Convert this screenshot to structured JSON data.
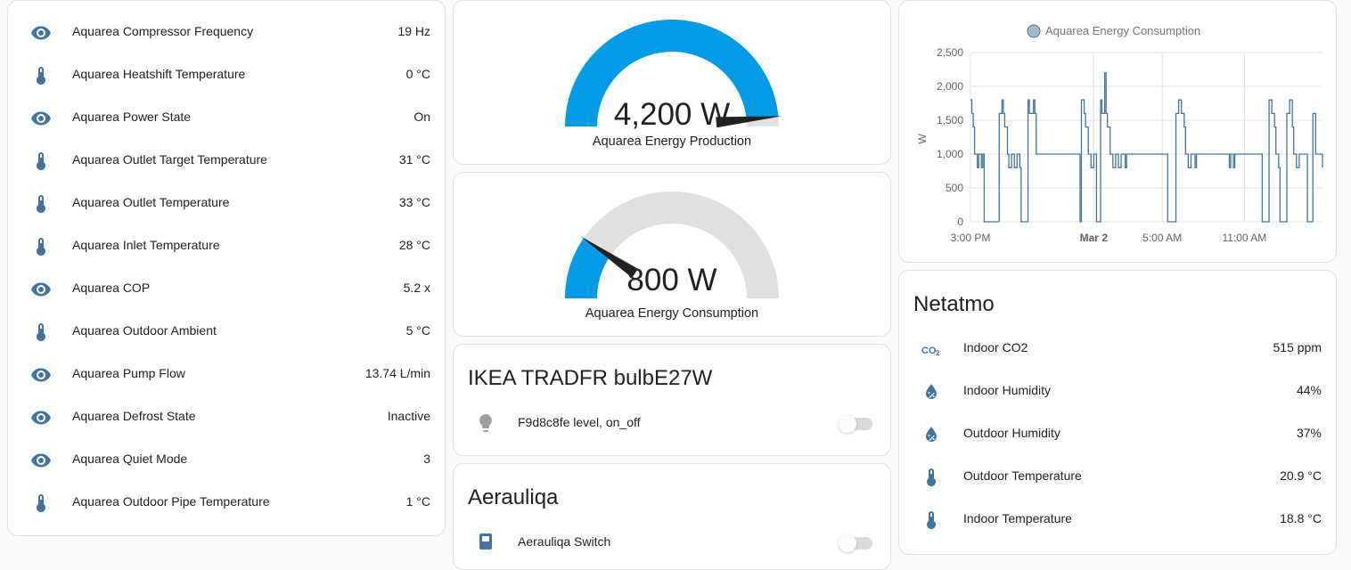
{
  "colors": {
    "icon": "#44739e",
    "gauge": "#039be5",
    "gauge_bg": "#e0e0e0",
    "line": "#44739e",
    "needle": "#212121"
  },
  "aquarea_card": {
    "rows": [
      {
        "icon": "eye-icon",
        "label": "Aquarea Compressor Frequency",
        "value": "19 Hz"
      },
      {
        "icon": "thermometer-icon",
        "label": "Aquarea Heatshift Temperature",
        "value": "0 °C"
      },
      {
        "icon": "eye-icon",
        "label": "Aquarea Power State",
        "value": "On"
      },
      {
        "icon": "thermometer-icon",
        "label": "Aquarea Outlet Target Temperature",
        "value": "31 °C"
      },
      {
        "icon": "thermometer-icon",
        "label": "Aquarea Outlet Temperature",
        "value": "33 °C"
      },
      {
        "icon": "thermometer-icon",
        "label": "Aquarea Inlet Temperature",
        "value": "28 °C"
      },
      {
        "icon": "eye-icon",
        "label": "Aquarea COP",
        "value": "5.2 x"
      },
      {
        "icon": "thermometer-icon",
        "label": "Aquarea Outdoor Ambient",
        "value": "5 °C"
      },
      {
        "icon": "eye-icon",
        "label": "Aquarea Pump Flow",
        "value": "13.74 L/min"
      },
      {
        "icon": "eye-icon",
        "label": "Aquarea Defrost State",
        "value": "Inactive"
      },
      {
        "icon": "eye-icon",
        "label": "Aquarea Quiet Mode",
        "value": "3"
      },
      {
        "icon": "thermometer-icon",
        "label": "Aquarea Outdoor Pipe Temperature",
        "value": "1 °C"
      }
    ]
  },
  "gauges": {
    "production": {
      "value_text": "4,200 W",
      "name": "Aquarea Energy Production",
      "fraction": 0.97
    },
    "consumption": {
      "value_text": "800 W",
      "name": "Aquarea Energy Consumption",
      "fraction": 0.19
    }
  },
  "ikea_card": {
    "title": "IKEA TRADFR bulbE27W",
    "entity": {
      "icon": "bulb-icon",
      "label": "F9d8c8fe level, on_off",
      "state": "off"
    }
  },
  "aerauliqa_card": {
    "title": "Aerauliqa",
    "entity": {
      "icon": "fan-switch-icon",
      "label": "Aerauliqa Switch",
      "state": "off"
    }
  },
  "netatmo_card": {
    "title": "Netatmo",
    "rows": [
      {
        "icon": "co2-icon",
        "label": "Indoor CO2",
        "value": "515 ppm"
      },
      {
        "icon": "humidity-icon",
        "label": "Indoor Humidity",
        "value": "44%"
      },
      {
        "icon": "humidity-icon",
        "label": "Outdoor Humidity",
        "value": "37%"
      },
      {
        "icon": "thermometer-icon",
        "label": "Outdoor Temperature",
        "value": "20.9 °C"
      },
      {
        "icon": "thermometer-icon",
        "label": "Indoor Temperature",
        "value": "18.8 °C"
      }
    ]
  },
  "chart_data": {
    "type": "line",
    "title": "",
    "legend": {
      "label": "Aquarea Energy Consumption",
      "placement": "top"
    },
    "ylabel": "W",
    "xlabel": "",
    "ylim": [
      0,
      2500
    ],
    "yticks": [
      "0",
      "500",
      "1,000",
      "1,500",
      "2,000",
      "2,500"
    ],
    "xticks": [
      "3:00 PM",
      "Mar 2",
      "5:00 AM",
      "11:00 AM"
    ],
    "x_hours": [
      0,
      9,
      14,
      20
    ],
    "x_range_hours": [
      0,
      25.7
    ],
    "grid": true,
    "series": [
      {
        "name": "Aquarea Energy Consumption",
        "points": [
          [
            0.0,
            1800
          ],
          [
            0.1,
            1600
          ],
          [
            0.2,
            1400
          ],
          [
            0.3,
            1000
          ],
          [
            0.5,
            800
          ],
          [
            0.6,
            1000
          ],
          [
            0.8,
            800
          ],
          [
            0.9,
            1000
          ],
          [
            1.0,
            0
          ],
          [
            1.2,
            0
          ],
          [
            1.4,
            0
          ],
          [
            2.0,
            0
          ],
          [
            2.1,
            1600
          ],
          [
            2.3,
            1800
          ],
          [
            2.4,
            1600
          ],
          [
            2.5,
            1400
          ],
          [
            2.7,
            1000
          ],
          [
            2.8,
            800
          ],
          [
            3.0,
            1000
          ],
          [
            3.2,
            800
          ],
          [
            3.4,
            1000
          ],
          [
            3.6,
            800
          ],
          [
            3.7,
            0
          ],
          [
            4.1,
            0
          ],
          [
            4.2,
            1800
          ],
          [
            4.3,
            1600
          ],
          [
            4.6,
            1800
          ],
          [
            4.7,
            1600
          ],
          [
            4.8,
            1000
          ],
          [
            7.9,
            1000
          ],
          [
            8.0,
            0
          ],
          [
            8.1,
            1800
          ],
          [
            8.3,
            1600
          ],
          [
            8.4,
            1400
          ],
          [
            8.6,
            1000
          ],
          [
            8.8,
            800
          ],
          [
            9.0,
            1000
          ],
          [
            9.2,
            0
          ],
          [
            9.5,
            1800
          ],
          [
            9.6,
            1600
          ],
          [
            9.8,
            2200
          ],
          [
            9.9,
            1600
          ],
          [
            10.0,
            1400
          ],
          [
            10.2,
            1000
          ],
          [
            10.4,
            800
          ],
          [
            10.6,
            1000
          ],
          [
            10.8,
            800
          ],
          [
            11.0,
            1000
          ],
          [
            11.3,
            800
          ],
          [
            11.4,
            1000
          ],
          [
            14.2,
            1000
          ],
          [
            14.4,
            0
          ],
          [
            14.9,
            0
          ],
          [
            15.0,
            1600
          ],
          [
            15.2,
            1800
          ],
          [
            15.4,
            1600
          ],
          [
            15.6,
            1400
          ],
          [
            15.7,
            1000
          ],
          [
            15.9,
            800
          ],
          [
            16.1,
            1000
          ],
          [
            16.3,
            1000
          ],
          [
            16.4,
            800
          ],
          [
            16.5,
            1000
          ],
          [
            18.8,
            1000
          ],
          [
            18.9,
            800
          ],
          [
            19.0,
            1000
          ],
          [
            19.2,
            800
          ],
          [
            19.3,
            1000
          ],
          [
            21.1,
            1000
          ],
          [
            21.3,
            0
          ],
          [
            21.7,
            0
          ],
          [
            21.8,
            1800
          ],
          [
            22.0,
            1600
          ],
          [
            22.2,
            1400
          ],
          [
            22.3,
            1000
          ],
          [
            22.5,
            800
          ],
          [
            22.6,
            0
          ],
          [
            23.0,
            0
          ],
          [
            23.1,
            1600
          ],
          [
            23.3,
            1800
          ],
          [
            23.5,
            1400
          ],
          [
            23.6,
            1000
          ],
          [
            23.8,
            800
          ],
          [
            24.0,
            1000
          ],
          [
            24.5,
            1000
          ],
          [
            24.6,
            0
          ],
          [
            24.9,
            0
          ],
          [
            25.0,
            1600
          ],
          [
            25.2,
            1000
          ],
          [
            25.6,
            1000
          ],
          [
            25.7,
            800
          ]
        ]
      }
    ]
  }
}
